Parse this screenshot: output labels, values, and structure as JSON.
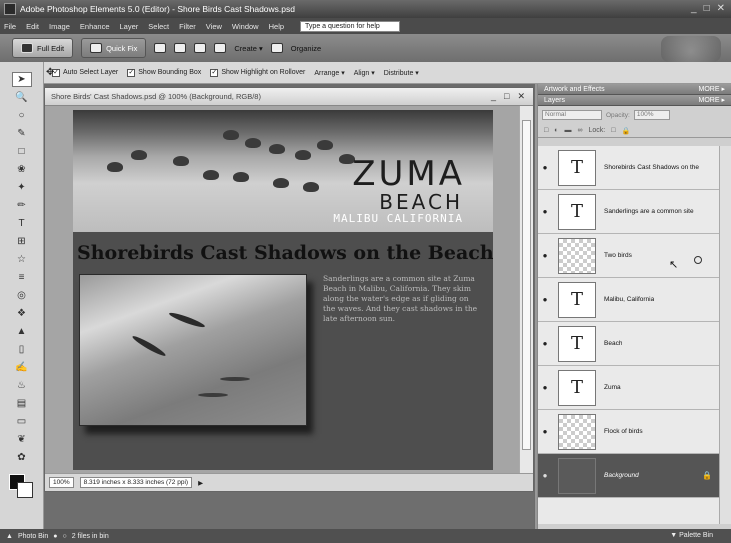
{
  "app": {
    "title": "Adobe Photoshop Elements 5.0 (Editor) - Shore Birds Cast Shadows.psd",
    "window_controls": [
      "_",
      "□",
      "✕"
    ]
  },
  "menu": {
    "items": [
      "File",
      "Edit",
      "Image",
      "Enhance",
      "Layer",
      "Select",
      "Filter",
      "View",
      "Window",
      "Help"
    ],
    "help_placeholder": "Type a question for help"
  },
  "shortcuts": {
    "full_edit": "Full Edit",
    "quick_fix": "Quick Fix",
    "create": "Create ▾",
    "organize": "Organize"
  },
  "options": {
    "auto_select": "Auto Select Layer",
    "show_bounding": "Show Bounding Box",
    "show_highlight": "Show Highlight on Rollover",
    "arrange": "Arrange ▾",
    "align": "Align ▾",
    "distribute": "Distribute ▾"
  },
  "document": {
    "title": "Shore Birds' Cast Shadows.psd @ 100% (Background, RGB/8)",
    "controls": [
      "_",
      "□",
      "✕"
    ],
    "zoom": "100%",
    "size_info": "8.319 inches x 8.333 inches (72 ppi)"
  },
  "artwork": {
    "zuma": "ZUMA",
    "beach": "BEACH",
    "location": "MALIBU CALIFORNIA",
    "headline": "Shorebirds Cast Shadows on the Beach",
    "body": "Sanderlings are a common site at Zuma Beach in Malibu, California. They skim along the water's edge as if gliding on the waves. And they cast shadows in the late afternoon sun."
  },
  "panels": {
    "artwork_effects": "Artwork and Effects",
    "layers": "Layers",
    "more": "MORE ▸",
    "blend_mode": "Normal",
    "opacity_label": "Opacity:",
    "opacity_value": "100%",
    "lock_label": "Lock:"
  },
  "layers": [
    {
      "name": "Shorebirds Cast Shadows on the",
      "thumb": "T",
      "kind": "text"
    },
    {
      "name": "Sanderlings are a common site",
      "thumb": "T",
      "kind": "text"
    },
    {
      "name": "Two birds",
      "thumb": "",
      "kind": "image"
    },
    {
      "name": "Malibu, California",
      "thumb": "T",
      "kind": "text"
    },
    {
      "name": "Beach",
      "thumb": "T",
      "kind": "text"
    },
    {
      "name": "Zuma",
      "thumb": "T",
      "kind": "text"
    },
    {
      "name": "Flock of birds",
      "thumb": "",
      "kind": "image"
    },
    {
      "name": "Background",
      "thumb": "",
      "kind": "background"
    }
  ],
  "bottom": {
    "photo_bin": "Photo Bin",
    "files_in_bin": "2 files in bin",
    "palette_bin": "Palette Bin"
  }
}
